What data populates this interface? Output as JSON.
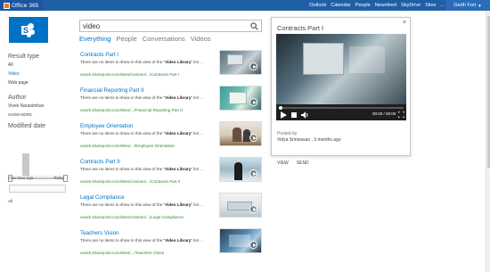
{
  "suite": {
    "brand": "Office 365",
    "links": [
      "Outlook",
      "Calendar",
      "People",
      "Newsfeed",
      "SkyDrive",
      "Sites"
    ],
    "ellipsis": "...",
    "user": "Garth Fort"
  },
  "search": {
    "query": "video"
  },
  "verticals": [
    "Everything",
    "People",
    "Conversations",
    "Videos"
  ],
  "refiners": {
    "result_type_heading": "Result type",
    "result_types": [
      "All",
      "Video",
      "Web page"
    ],
    "author_heading": "Author",
    "authors": [
      "Vivek Narasimhan"
    ],
    "show_more": "SHOW MORE",
    "modified_heading": "Modified date",
    "slider_left": "One Year Ago",
    "slider_right": "Today",
    "slider_all": "All"
  },
  "results": [
    {
      "title": "Contracts Part I",
      "snippet_pre": "There are no items to show in this view of the \"",
      "snippet_bold": "Video Library",
      "snippet_post": "\" list ...",
      "url": "vavek.sharepoint.com/sites/contoso/.../Contracts Part I"
    },
    {
      "title": "Financial Reporting Part II",
      "snippet_pre": "There are no items to show in this view of the \"",
      "snippet_bold": "Video Library",
      "snippet_post": "\" list ...",
      "url": "vavek.sharepoint.com/sites/.../Financial Reporting Part II"
    },
    {
      "title": "Employee Orientation",
      "snippet_pre": "There are no items to show in this view of the \"",
      "snippet_bold": "Video Library",
      "snippet_post": "\" list ...",
      "url": "vavek.sharepoint.com/sites/.../Employee Orientation"
    },
    {
      "title": "Contracts Part II",
      "snippet_pre": "There are no items to show in this view of the \"",
      "snippet_bold": "Video Library",
      "snippet_post": "\" list ...",
      "url": "vavek.sharepoint.com/sites/contoso/.../Contracts Part II"
    },
    {
      "title": "Legal Compliance",
      "snippet_pre": "There are no items to show in this view of the \"",
      "snippet_bold": "Video Library",
      "snippet_post": "\" list ...",
      "url": "vavek.sharepoint.com/sites/contoso/.../Legal Compliance"
    },
    {
      "title": "Teachers Vision",
      "snippet_pre": "There are no items to show in this view of the \"",
      "snippet_bold": "Video Library",
      "snippet_post": "\" list ...",
      "url": "vavek.sharepoint.com/sites/.../Teachers Vision"
    }
  ],
  "hover": {
    "title": "Contracts Part I",
    "close": "×",
    "time": "00:00 / 00:00",
    "posted_by_label": "Posted by",
    "author": "Vidya Srinivasan , 3 months ago",
    "actions": [
      "VIEW",
      "SEND"
    ]
  }
}
